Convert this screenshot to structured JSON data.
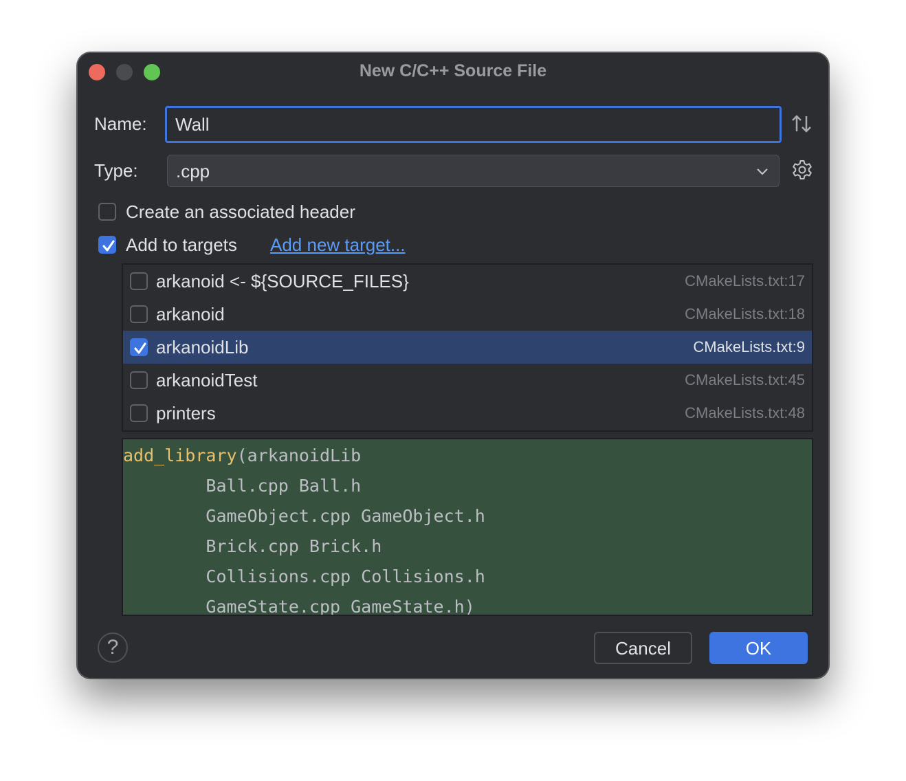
{
  "window": {
    "title": "New C/C++ Source File",
    "controls": [
      "close",
      "minimize",
      "maximize"
    ]
  },
  "form": {
    "name_label": "Name:",
    "name_value": "Wall",
    "type_label": "Type:",
    "type_value": ".cpp",
    "sort_icon": "sort-up-down-icon",
    "gear_icon": "gear-icon",
    "create_header_label": "Create an associated header",
    "create_header_checked": false,
    "add_targets_label": "Add to targets",
    "add_targets_checked": true,
    "add_new_target_link": "Add new target..."
  },
  "targets": [
    {
      "name": "arkanoid <- ${SOURCE_FILES}",
      "location": "CMakeLists.txt:17",
      "checked": false,
      "selected": false
    },
    {
      "name": "arkanoid",
      "location": "CMakeLists.txt:18",
      "checked": false,
      "selected": false
    },
    {
      "name": "arkanoidLib",
      "location": "CMakeLists.txt:9",
      "checked": true,
      "selected": true
    },
    {
      "name": "arkanoidTest",
      "location": "CMakeLists.txt:45",
      "checked": false,
      "selected": false
    },
    {
      "name": "printers",
      "location": "CMakeLists.txt:48",
      "checked": false,
      "selected": false
    }
  ],
  "code_preview": {
    "function": "add_library",
    "first_line_rest": "(arkanoidLib",
    "lines": [
      "        Ball.cpp Ball.h",
      "        GameObject.cpp GameObject.h",
      "        Brick.cpp Brick.h",
      "        Collisions.cpp Collisions.h",
      "        GameState.cpp GameState.h)"
    ]
  },
  "footer": {
    "help_label": "?",
    "cancel_label": "Cancel",
    "ok_label": "OK"
  },
  "colors": {
    "accent": "#3d74e0",
    "background": "#2b2d30",
    "selection": "#2e436e",
    "code_background": "#36523f",
    "link": "#5c9bf7",
    "function_name": "#e8bf6a"
  }
}
